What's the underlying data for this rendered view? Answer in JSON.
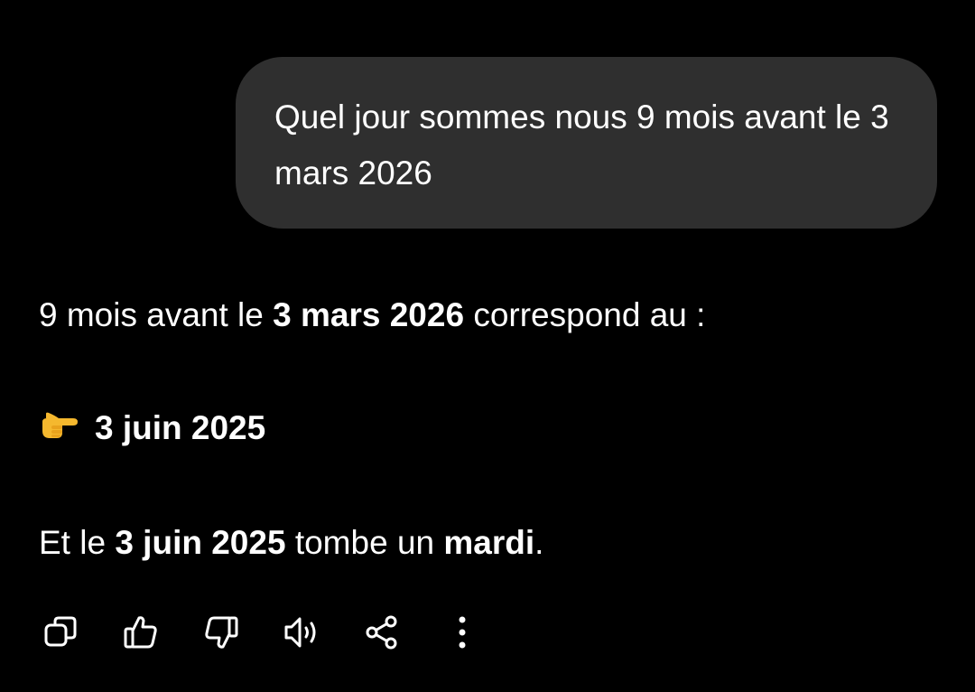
{
  "user_message": {
    "text": "Quel jour sommes nous 9 mois avant le 3 mars 2026"
  },
  "assistant_message": {
    "line1": {
      "prefix": "9 mois avant le ",
      "bold": "3 mars 2026",
      "suffix": " correspond au :"
    },
    "line2": {
      "emoji": "backhand-index-pointing-right",
      "bold": "3 juin 2025"
    },
    "line3": {
      "prefix": "Et le ",
      "bold1": "3 juin 2025",
      "middle": " tombe un ",
      "bold2": "mardi",
      "suffix": "."
    }
  },
  "actions": [
    {
      "icon": "copy-icon"
    },
    {
      "icon": "thumbs-up-icon"
    },
    {
      "icon": "thumbs-down-icon"
    },
    {
      "icon": "read-aloud-icon"
    },
    {
      "icon": "share-icon"
    },
    {
      "icon": "more-options-icon"
    }
  ],
  "colors": {
    "background": "#000000",
    "bubble": "#2f2f2f",
    "text": "#ffffff",
    "emoji": "#f5b82e"
  }
}
